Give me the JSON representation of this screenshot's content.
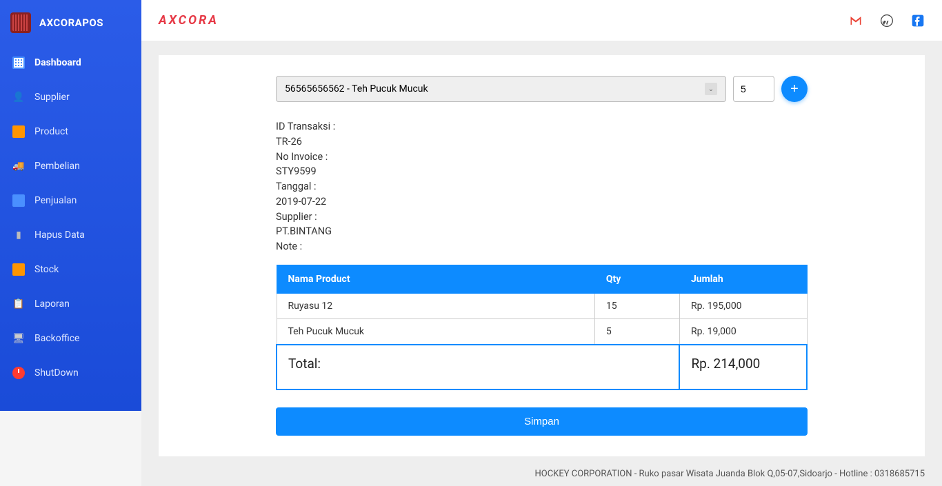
{
  "app_title": "AXCORAPOS",
  "brand": "AXCORA",
  "sidebar": {
    "items": [
      {
        "label": "Dashboard",
        "icon": "grid"
      },
      {
        "label": "Supplier",
        "icon": "person"
      },
      {
        "label": "Product",
        "icon": "orange"
      },
      {
        "label": "Pembelian",
        "icon": "truck"
      },
      {
        "label": "Penjualan",
        "icon": "calc"
      },
      {
        "label": "Hapus Data",
        "icon": "trash"
      },
      {
        "label": "Stock",
        "icon": "orange"
      },
      {
        "label": "Laporan",
        "icon": "clip"
      },
      {
        "label": "Backoffice",
        "icon": "monitor"
      },
      {
        "label": "ShutDown",
        "icon": "power"
      }
    ]
  },
  "form": {
    "product_selected": "56565656562 - Teh Pucuk Mucuk",
    "qty_value": "5",
    "add_label": "+"
  },
  "info": {
    "id_label": "ID Transaksi : ",
    "id_value": "TR-26",
    "invoice_label": "No Invoice : ",
    "invoice_value": "STY9599",
    "date_label": "Tanggal : ",
    "date_value": "2019-07-22",
    "supplier_label": "Supplier : ",
    "supplier_value": "PT.BINTANG",
    "note_label": "Note :",
    "note_value": ""
  },
  "table": {
    "headers": [
      "Nama Product",
      "Qty",
      "Jumlah"
    ],
    "rows": [
      {
        "name": "Ruyasu 12",
        "qty": "15",
        "amount": "Rp. 195,000"
      },
      {
        "name": "Teh Pucuk Mucuk",
        "qty": "5",
        "amount": "Rp. 19,000"
      }
    ],
    "total_label": "Total:",
    "total_value": "Rp. 214,000"
  },
  "save_label": "Simpan",
  "footer": "HOCKEY CORPORATION - Ruko pasar Wisata Juanda Blok Q,05-07,Sidoarjo - Hotline : 0318685715"
}
